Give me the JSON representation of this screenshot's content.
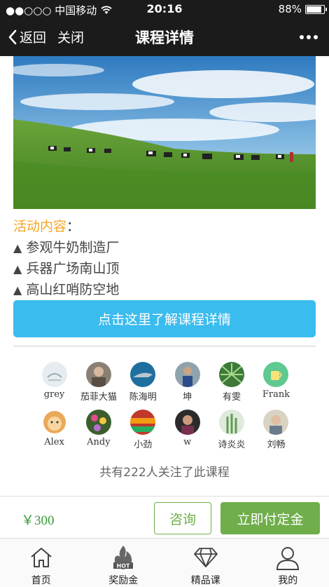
{
  "status_bar": {
    "carrier": "●●○○○ 中国移动",
    "time": "20:16",
    "battery": "88%",
    "battery_level": 0.88
  },
  "nav": {
    "back_label": "返回",
    "close_label": "关闭",
    "title": "课程详情"
  },
  "activity": {
    "heading": "活动内容",
    "colon": "：",
    "items": [
      "参观牛奶制造厂",
      "兵器广场南山顶",
      "高山红哨防空地"
    ]
  },
  "detail_button": "点击这里了解课程详情",
  "followers": [
    {
      "name": "grey",
      "icon": "grey-logo-avatar"
    },
    {
      "name": "茄菲大猫",
      "icon": "person-photo-avatar"
    },
    {
      "name": "陈海明",
      "icon": "shark-photo-avatar"
    },
    {
      "name": "坤",
      "icon": "person-photo-avatar"
    },
    {
      "name": "有雯",
      "icon": "plant-photo-avatar"
    },
    {
      "name": "Frank",
      "icon": "cup-avatar"
    },
    {
      "name": "Alex",
      "icon": "cartoon-lion-avatar"
    },
    {
      "name": "Andy",
      "icon": "flowers-photo-avatar"
    },
    {
      "name": "小劲",
      "icon": "colorful-photo-avatar"
    },
    {
      "name": "w",
      "icon": "person-photo-avatar"
    },
    {
      "name": "诗炎炎",
      "icon": "plant-photo-avatar"
    },
    {
      "name": "刘畅",
      "icon": "person-photo-avatar"
    }
  ],
  "follow_count_text": "共有222人关注了此课程",
  "purchase": {
    "price": "￥300",
    "consult": "咨询",
    "deposit": "立即付定金"
  },
  "tabs": [
    {
      "label": "首页",
      "icon": "home-icon"
    },
    {
      "label": "奖励金",
      "icon": "hot-flame-icon"
    },
    {
      "label": "精品课",
      "icon": "diamond-icon"
    },
    {
      "label": "我的",
      "icon": "person-icon"
    }
  ],
  "colors": {
    "accent_orange": "#f5a623",
    "button_blue": "#3bbcee",
    "green": "#6fae4a",
    "bar_dark": "#1b1b1b"
  }
}
